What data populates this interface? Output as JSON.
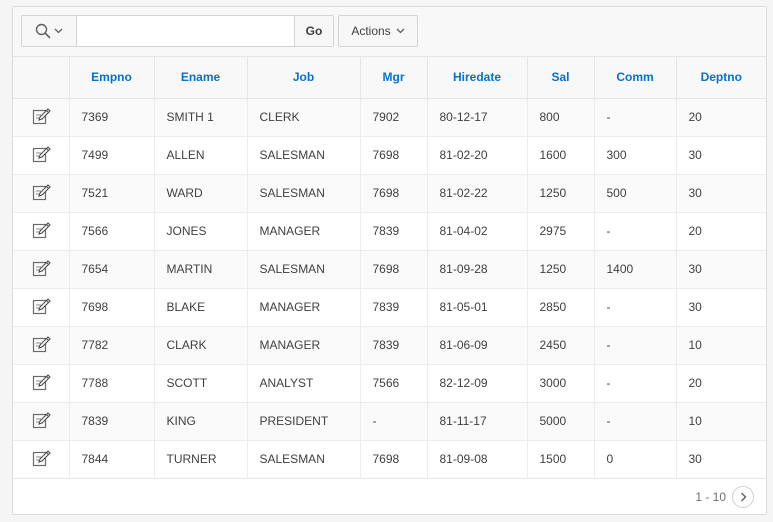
{
  "toolbar": {
    "search_icon": "search-icon",
    "search_value": "",
    "search_placeholder": "",
    "go_label": "Go",
    "actions_label": "Actions"
  },
  "report": {
    "columns": [
      "",
      "Empno",
      "Ename",
      "Job",
      "Mgr",
      "Hiredate",
      "Sal",
      "Comm",
      "Deptno"
    ],
    "edit_icon": "edit-icon",
    "rows": [
      [
        "7369",
        "SMITH 1",
        "CLERK",
        "7902",
        "80-12-17",
        "800",
        "-",
        "20"
      ],
      [
        "7499",
        "ALLEN",
        "SALESMAN",
        "7698",
        "81-02-20",
        "1600",
        "300",
        "30"
      ],
      [
        "7521",
        "WARD",
        "SALESMAN",
        "7698",
        "81-02-22",
        "1250",
        "500",
        "30"
      ],
      [
        "7566",
        "JONES",
        "MANAGER",
        "7839",
        "81-04-02",
        "2975",
        "-",
        "20"
      ],
      [
        "7654",
        "MARTIN",
        "SALESMAN",
        "7698",
        "81-09-28",
        "1250",
        "1400",
        "30"
      ],
      [
        "7698",
        "BLAKE",
        "MANAGER",
        "7839",
        "81-05-01",
        "2850",
        "-",
        "30"
      ],
      [
        "7782",
        "CLARK",
        "MANAGER",
        "7839",
        "81-06-09",
        "2450",
        "-",
        "10"
      ],
      [
        "7788",
        "SCOTT",
        "ANALYST",
        "7566",
        "82-12-09",
        "3000",
        "-",
        "20"
      ],
      [
        "7839",
        "KING",
        "PRESIDENT",
        "-",
        "81-11-17",
        "5000",
        "-",
        "10"
      ],
      [
        "7844",
        "TURNER",
        "SALESMAN",
        "7698",
        "81-09-08",
        "1500",
        "0",
        "30"
      ]
    ]
  },
  "pagination": {
    "label": "1 - 10",
    "next_icon": "chevron-right-icon"
  },
  "colors": {
    "header_link": "#0572ce",
    "border": "#e6e6e6"
  }
}
